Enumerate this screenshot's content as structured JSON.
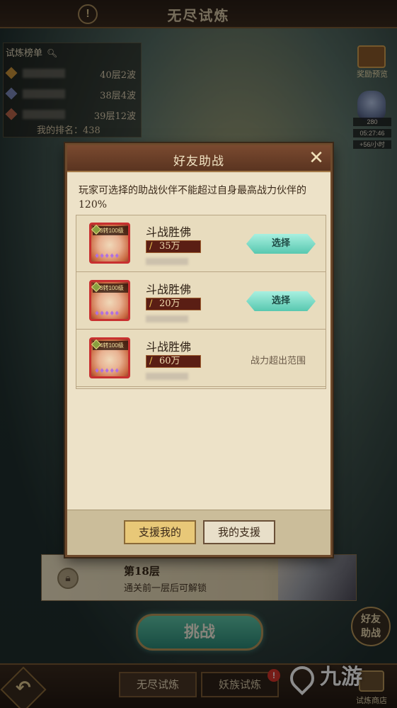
{
  "header": {
    "title": "无尽试炼",
    "info_icon": "!"
  },
  "ranking": {
    "title": "试炼榜单",
    "search_icon": "magnifier-icon",
    "rows": [
      {
        "rank_icon": "gold-gem",
        "color": "#c8923a",
        "score": "40层2波"
      },
      {
        "rank_icon": "silver-gem",
        "color": "#7a88b8",
        "score": "38层4波"
      },
      {
        "rank_icon": "bronze-gem",
        "color": "#b8644a",
        "score": "39层12波"
      }
    ],
    "my_rank": "我的排名：438"
  },
  "side": {
    "reward_label": "奖励预览",
    "resource_count": "280",
    "timer": "05:27:46",
    "rate": "+56/小时"
  },
  "floors": [
    {
      "title": "第18层",
      "desc": "通关前一层后可解锁"
    }
  ],
  "modal": {
    "title": "好友助战",
    "close_symbol": "✕",
    "notice": "玩家可选择的助战伙伴不能超过自身最高战力伙伴的120%",
    "rows": [
      {
        "name": "斗战胜佛",
        "level": "3转100级",
        "power": "35万",
        "stars": "♦♦♦♦♦",
        "status": "select",
        "action_label": "选择"
      },
      {
        "name": "斗战胜佛",
        "level": "3转100级",
        "power": "20万",
        "stars": "♦♦♦♦♦",
        "status": "select",
        "action_label": "选择"
      },
      {
        "name": "斗战胜佛",
        "level": "4转100级",
        "power": "60万",
        "stars": "♦♦♦♦♦",
        "status": "over",
        "action_label": "战力超出范围"
      }
    ],
    "tabs": [
      {
        "label": "支援我的",
        "active": true
      },
      {
        "label": "我的支援",
        "active": false
      }
    ]
  },
  "buttons": {
    "challenge": "挑战",
    "friend_assist": "好友助战"
  },
  "bottom": {
    "tabs": [
      {
        "label": "无尽试炼",
        "active": true
      },
      {
        "label": "妖族试炼",
        "active": false
      }
    ],
    "badge": "!",
    "shop_label": "试炼商店"
  },
  "watermark": {
    "text": "九游"
  }
}
